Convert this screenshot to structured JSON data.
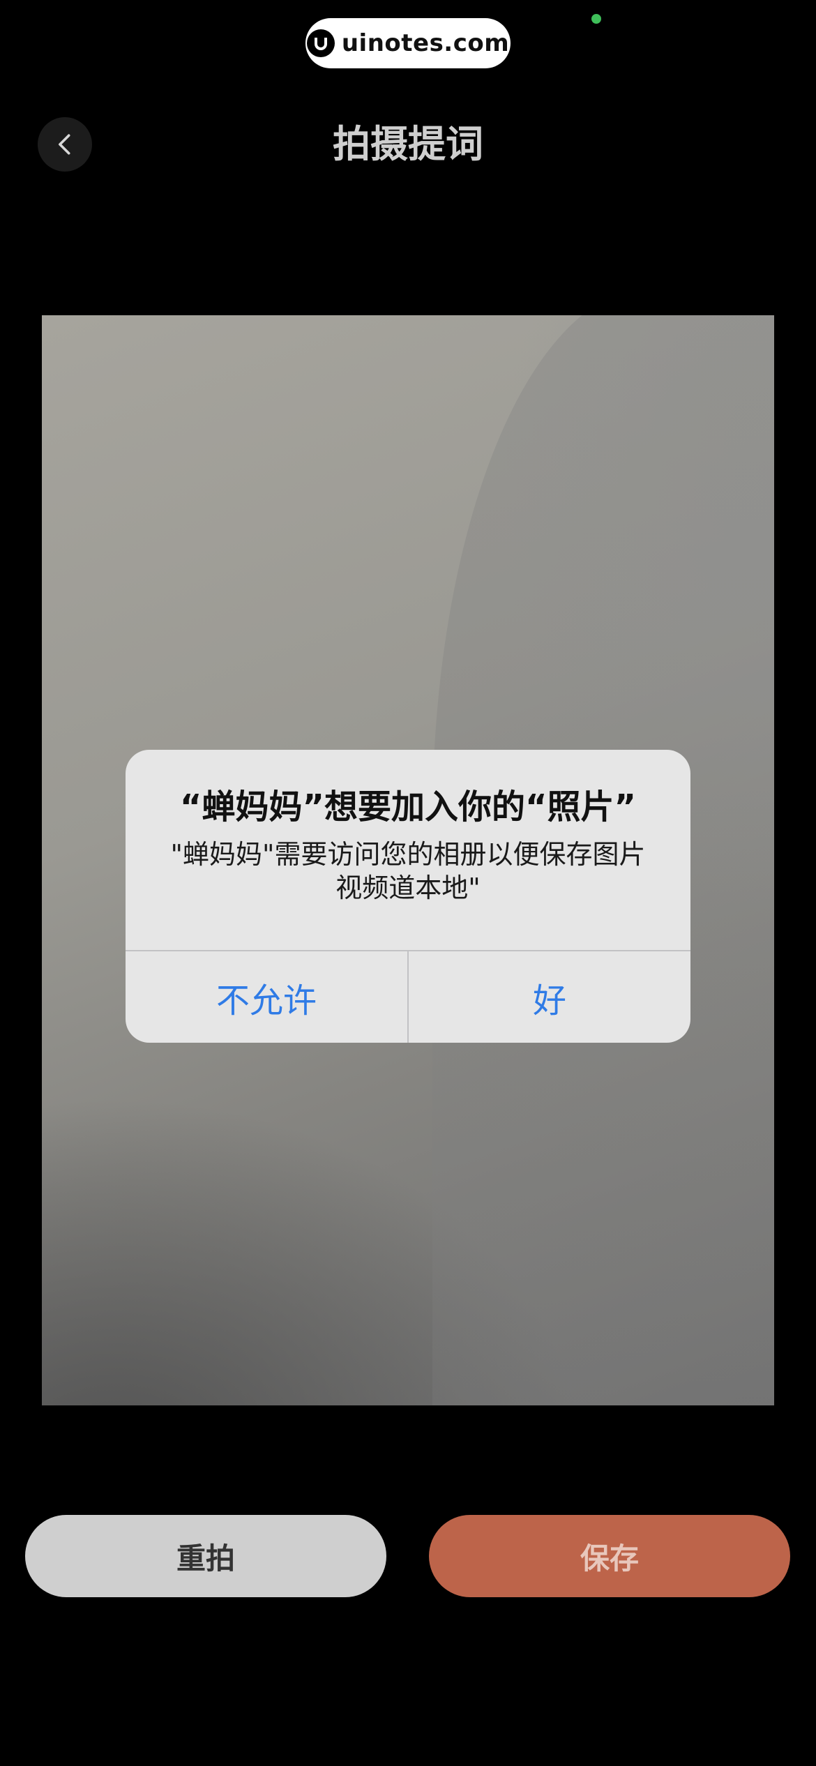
{
  "watermark": {
    "text": "uinotes.com"
  },
  "header": {
    "back_icon": "chevron-left-icon",
    "title": "拍摄提词"
  },
  "alert": {
    "title": "“蝉妈妈”想要加入你的“照片”",
    "message": "\"蝉妈妈\"需要访问您的相册以便保存图片视频道本地\"",
    "message_line1": "\"蝉妈妈\"需要访问您的相册以便保存图片",
    "message_line2": "视频道本地\"",
    "deny_label": "不允许",
    "allow_label": "好",
    "button_color": "#2f7be6"
  },
  "actions": {
    "retake_label": "重拍",
    "save_label": "保存",
    "save_color": "#bd644a"
  }
}
